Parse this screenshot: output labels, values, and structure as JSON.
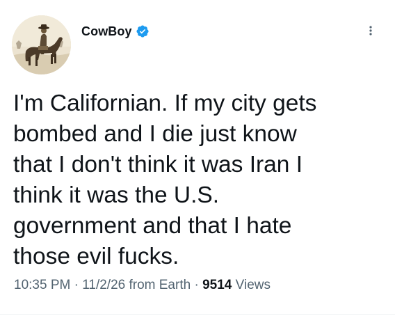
{
  "author": {
    "display_name": "CowBoy",
    "verified": true,
    "avatar_icon": "cowboy-on-horse-avatar"
  },
  "tweet": {
    "text": "I'm Californian. If my city gets\nbombed and I die just know\nthat I don't think it was Iran I\nthink it was the U.S.\ngovernment and that I hate\nthose evil fucks.",
    "time": "10:35 PM",
    "date": "11/2/26",
    "source": "from Earth",
    "separator": "·",
    "views_count": "9514",
    "views_label": "Views"
  },
  "icons": {
    "verified": "verified-badge-icon",
    "more": "more-options-icon"
  },
  "colors": {
    "text_primary": "#0f1419",
    "text_secondary": "#536471",
    "verified_blue": "#1d9bf0"
  }
}
